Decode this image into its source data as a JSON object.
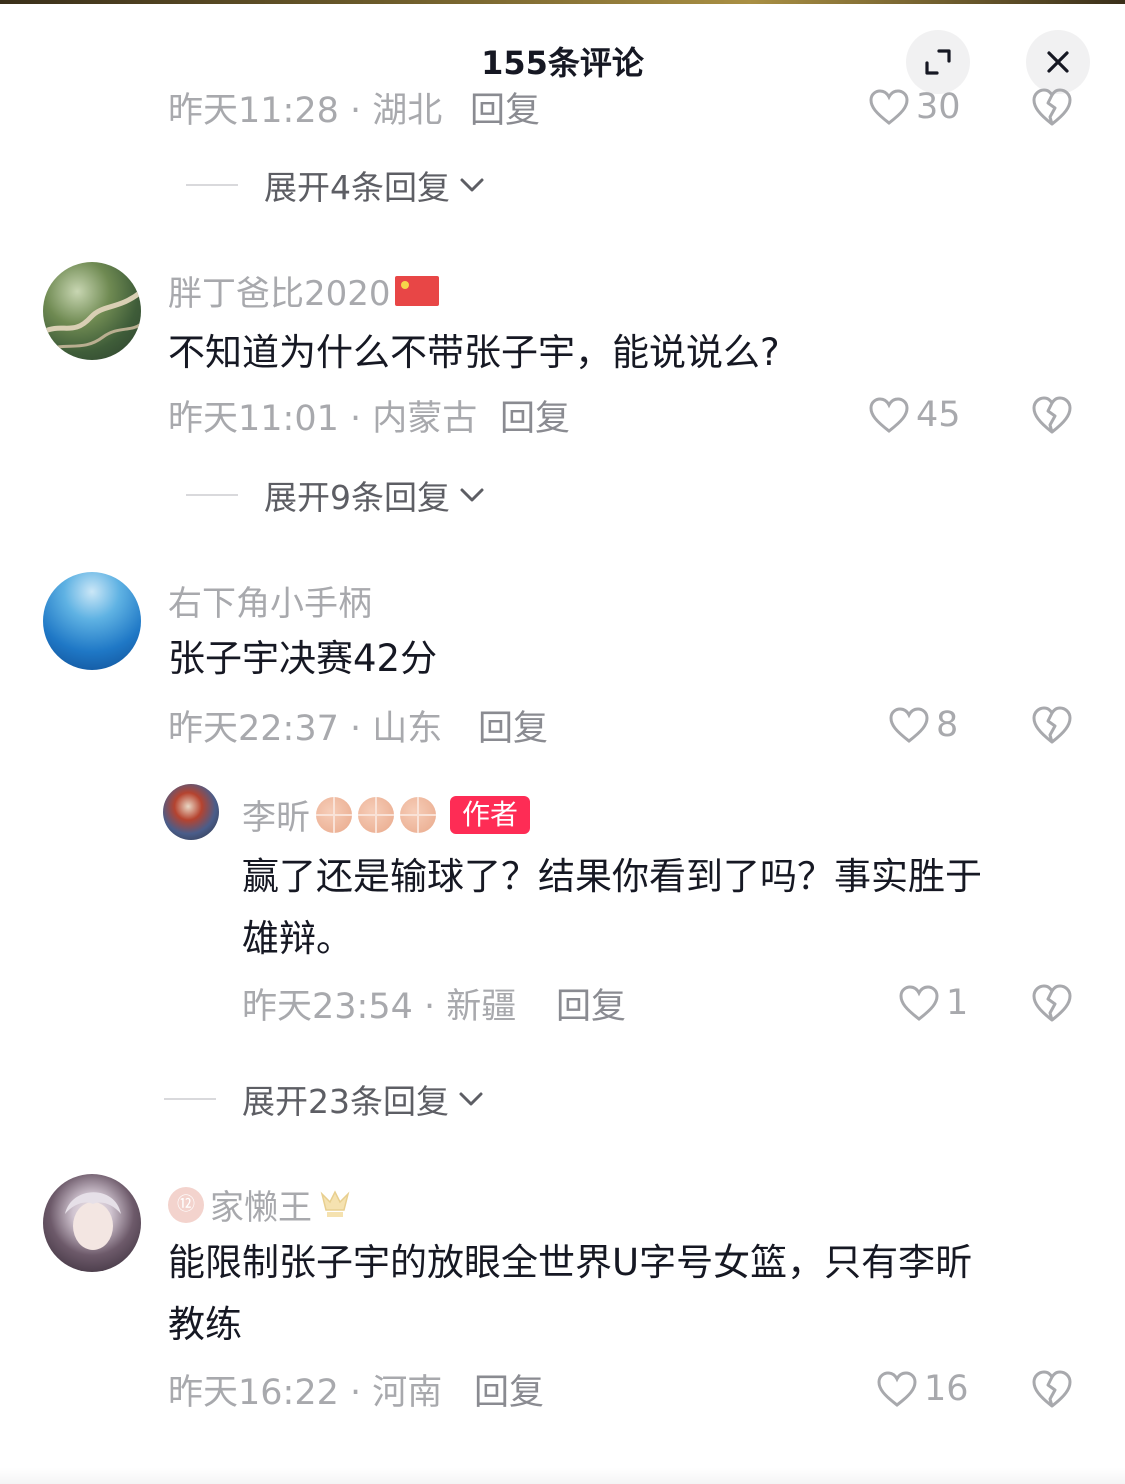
{
  "header": {
    "title": "155条评论",
    "expand_icon": "fullscreen-icon",
    "close_icon": "close-icon"
  },
  "reply_label": "回复",
  "comments": [
    {
      "time_location": "昨天11:28 · 湖北",
      "likes": "30",
      "expand": "展开4条回复"
    },
    {
      "username": "胖丁爸比2020",
      "text": "不知道为什么不带张子宇，能说说么?",
      "time_location": "昨天11:01 · 内蒙古",
      "likes": "45",
      "expand": "展开9条回复"
    },
    {
      "username": "右下角小手柄",
      "text": "张子宇决赛42分",
      "time_location": "昨天22:37 · 山东",
      "likes": "8",
      "reply": {
        "username": "李昕",
        "badge": "作者",
        "text_line1": "赢了还是输球了？结果你看到了吗？事实胜于",
        "text_line2": "雄辩。",
        "time_location": "昨天23:54 · 新疆",
        "likes": "1"
      },
      "expand": "展开23条回复"
    },
    {
      "zodiac_badge": "⑫",
      "username": "家懒王",
      "text_line1": "能限制张子宇的放眼全世界U字号女篮，只有李昕",
      "text_line2": "教练",
      "time_location": "昨天16:22 · 河南",
      "likes": "16"
    }
  ],
  "colors": {
    "accent": "#fe2c55",
    "text": "#161823",
    "muted": "#a8a9ad"
  }
}
